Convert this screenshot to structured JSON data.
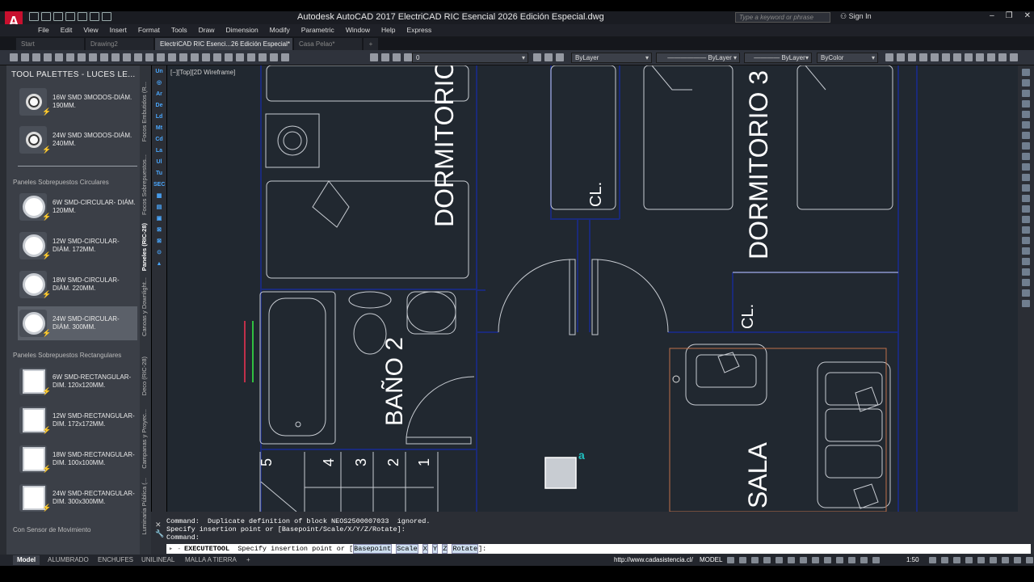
{
  "app": {
    "logo": "A",
    "title": "Autodesk AutoCAD 2017    ElectriCAD RIC Esencial 2026 Edición Especial.dwg",
    "search_placeholder": "Type a keyword or phrase",
    "signin": "Sign In"
  },
  "menu": [
    "File",
    "Edit",
    "View",
    "Insert",
    "Format",
    "Tools",
    "Draw",
    "Dimension",
    "Modify",
    "Parametric",
    "Window",
    "Help",
    "Express"
  ],
  "tabs": [
    "Start",
    "Drawing2",
    "ElectriCAD RIC Esenci...26 Edición Especial*",
    "Casa Pelao*",
    "+"
  ],
  "toolbar": {
    "layer": "0",
    "color": "ByLayer",
    "linetype": "ByLayer",
    "lineweight": "ByLayer",
    "plotstyle": "ByColor"
  },
  "palette": {
    "title": "TOOL PALETTES - LUCES LE...",
    "items_top": [
      {
        "label": "16W SMD 3MODOS-DIÁM. 190MM."
      },
      {
        "label": "24W SMD 3MODOS-DIÁM. 240MM."
      }
    ],
    "section_circ": "Paneles Sobrepuestos Circulares",
    "items_circ": [
      {
        "label": "6W SMD-CIRCULAR- DIÁM. 120MM."
      },
      {
        "label": "12W SMD-CIRCULAR-DIÁM. 172MM."
      },
      {
        "label": "18W SMD-CIRCULAR-DIÁM. 220MM."
      },
      {
        "label": "24W SMD-CIRCULAR-DIÁM. 300MM."
      }
    ],
    "section_rect": "Paneles Sobrepuestos Rectangulares",
    "items_rect": [
      {
        "label": "6W SMD-RECTANGULAR-DIM. 120x120MM."
      },
      {
        "label": "12W SMD-RECTANGULAR-DIM. 172x172MM."
      },
      {
        "label": "18W SMD-RECTANGULAR-DIM. 100x100MM."
      },
      {
        "label": "24W SMD-RECTANGULAR-DIM. 300x300MM."
      }
    ],
    "section_sensor": "Con Sensor de Movimiento",
    "vtabs": [
      "Focos Embutidos (R...",
      "Focos Sobrepuestos...",
      "Paneles (RIC-28)",
      "Canoas y Downlight...",
      "Deco (RIC-28)",
      "Campanas y Proyec...",
      "Luminaria Pública (..."
    ],
    "strip": [
      "Un",
      "◎",
      "Ar",
      "De",
      "Ld",
      "Mt",
      "Cd",
      "La",
      "Ul",
      "Tu",
      "SEC",
      "▦",
      "▤",
      "▣",
      "⊠",
      "⊠",
      "⊙",
      "▲"
    ]
  },
  "viewport_label": "[−][Top][2D Wireframe]",
  "drawing": {
    "rooms": [
      "DORMITORIO",
      "DORMITORIO 3",
      "CL.",
      "CL.",
      "BAÑO 2",
      "SALA"
    ],
    "stair_numbers": [
      "5",
      "4",
      "3",
      "2",
      "1"
    ],
    "marker": "a"
  },
  "command": {
    "history": [
      "Command:  Duplicate definition of block NEOS2500007033  ignored.",
      "Specify insertion point or [Basepoint/Scale/X/Y/Z/Rotate]:",
      "Command:"
    ],
    "current_cmd": "EXECUTETOOL",
    "prompt": "Specify insertion point or [",
    "options": [
      "Basepoint",
      "Scale",
      "X",
      "Y",
      "Z",
      "Rotate"
    ],
    "prompt_end": "]:"
  },
  "layout_tabs": [
    "Model",
    "ALUMBRADO",
    "ENCHUFES",
    "UNILINEAL",
    "MALLA A TIERRA",
    "+"
  ],
  "status": {
    "url": "http://www.cadasistencia.cl/",
    "space": "MODEL",
    "scale": "1:50"
  },
  "colors": {
    "canvas_bg": "#212830",
    "wall": "#1a2a7a",
    "line": "#c8ccd2",
    "accent_cyan": "#20c0c0"
  }
}
